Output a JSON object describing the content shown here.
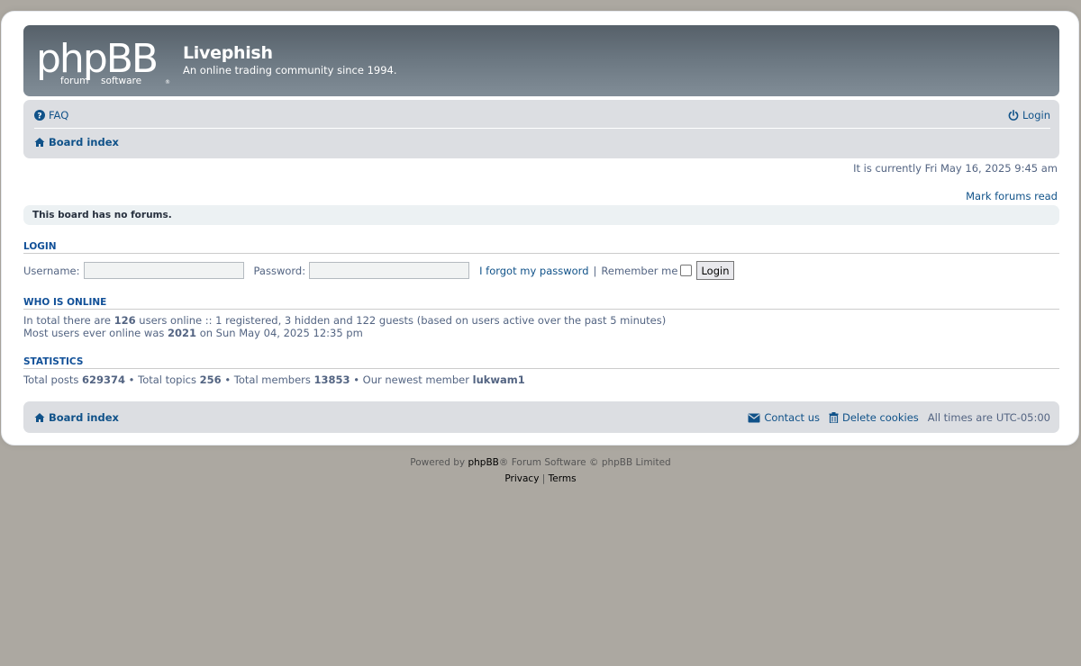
{
  "header": {
    "site_title": "Livephish",
    "site_description": "An online trading community since 1994.",
    "logo_text": "phpBB",
    "logo_subtext_left": "forum",
    "logo_subtext_right": "software"
  },
  "navbar": {
    "faq_label": "FAQ",
    "login_label": "Login",
    "board_index_label": "Board index"
  },
  "current_time": "It is currently Fri May 16, 2025 9:45 am",
  "mark_forums_read": "Mark forums read",
  "no_forums_notice": "This board has no forums.",
  "login_section": {
    "title": "LOGIN",
    "username_label": "Username:",
    "username_value": "",
    "password_label": "Password:",
    "password_value": "",
    "forgot_password": "I forgot my password",
    "separator": "|",
    "remember_me_label": "Remember me",
    "remember_me_checked": false,
    "login_button": "Login"
  },
  "who_is_online": {
    "title": "WHO IS ONLINE",
    "line1_prefix": "In total there are",
    "total_online": "126",
    "line1_suffix": "users online :: 1 registered, 3 hidden and 122 guests (based on users active over the past 5 minutes)",
    "line2_prefix": "Most users ever online was",
    "max_online": "2021",
    "line2_suffix": "on Sun May 04, 2025 12:35 pm"
  },
  "statistics": {
    "title": "STATISTICS",
    "posts_label": "Total posts",
    "posts_value": "629374",
    "topics_label": "Total topics",
    "topics_value": "256",
    "members_label": "Total members",
    "members_value": "13853",
    "newest_label": "Our newest member",
    "newest_member": "lukwam1",
    "bullet": "•"
  },
  "footer_nav": {
    "board_index_label": "Board index",
    "contact_label": "Contact us",
    "delete_cookies_label": "Delete cookies",
    "times_label": "All times are",
    "timezone": "UTC-05:00"
  },
  "page_footer": {
    "powered_prefix": "Powered by",
    "powered_brand": "phpBB",
    "powered_suffix": "® Forum Software © phpBB Limited",
    "privacy": "Privacy",
    "divider": "|",
    "terms": "Terms"
  },
  "colors": {
    "page_background": "#aca8a1",
    "link": "#105289",
    "navbar_bg": "#dcdee2",
    "header_gradient_top": "#566069",
    "header_gradient_bottom": "#818d97",
    "section_title": "#115098"
  }
}
